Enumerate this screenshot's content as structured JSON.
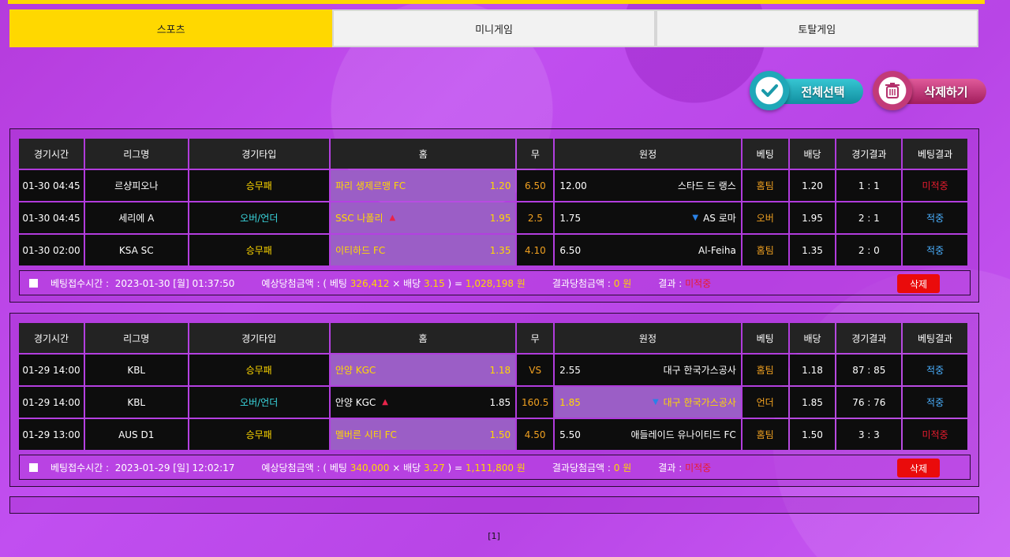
{
  "tabs": [
    "스포츠",
    "미니게임",
    "토탈게임"
  ],
  "actions": {
    "select_all": "전체선택",
    "delete": "삭제하기"
  },
  "headers": [
    "경기시간",
    "리그명",
    "경기타입",
    "홈",
    "무",
    "원정",
    "베팅",
    "배당",
    "경기결과",
    "베팅결과"
  ],
  "bets": [
    {
      "rows": [
        {
          "time": "01-30 04:45",
          "league": "르샹피오나",
          "type": "승무패",
          "home": "파리 생제르맹 FC",
          "home_odds": "1.20",
          "draw": "6.50",
          "away_odds": "12.00",
          "away": "스타드 드 랭스",
          "bet": "홈팀",
          "odds": "1.20",
          "score": "1 : 1",
          "result": "미적중"
        },
        {
          "time": "01-30 04:45",
          "league": "세리에 A",
          "type": "오버/언더",
          "home": "SSC 나폴리",
          "home_odds": "1.95",
          "draw": "2.5",
          "away_odds": "1.75",
          "away": "AS 로마",
          "bet": "오버",
          "odds": "1.95",
          "score": "2 : 1",
          "result": "적중"
        },
        {
          "time": "01-30 02:00",
          "league": "KSA SC",
          "type": "승무패",
          "home": "이티하드 FC",
          "home_odds": "1.35",
          "draw": "4.10",
          "away_odds": "6.50",
          "away": "Al-Feiha",
          "bet": "홈팀",
          "odds": "1.35",
          "score": "2 : 0",
          "result": "적중"
        }
      ],
      "info": {
        "time_label": "베팅접수시간 :",
        "time_value": "2023-01-30 [월] 01:37:50",
        "expected_label": "예상당첨금액 : ( 베팅",
        "bet_amount": "326,412",
        "times": "× 배당",
        "total_odds": "3.15",
        "eq": ") =",
        "expected_value": "1,028,198 원",
        "result_amount_label": "결과당첨금액 :",
        "result_amount": "0 원",
        "result_label": "결과 :",
        "result_value": "미적중",
        "delete": "삭제"
      }
    },
    {
      "rows": [
        {
          "time": "01-29 14:00",
          "league": "KBL",
          "type": "승무패",
          "home": "안양 KGC",
          "home_odds": "1.18",
          "draw": "VS",
          "away_odds": "2.55",
          "away": "대구 한국가스공사",
          "bet": "홈팀",
          "odds": "1.18",
          "score": "87 : 85",
          "result": "적중"
        },
        {
          "time": "01-29 14:00",
          "league": "KBL",
          "type": "오버/언더",
          "home": "안양 KGC",
          "home_odds": "1.85",
          "draw": "160.5",
          "away_odds": "1.85",
          "away": "대구 한국가스공사",
          "bet": "언더",
          "odds": "1.85",
          "score": "76 : 76",
          "result": "적중"
        },
        {
          "time": "01-29 13:00",
          "league": "AUS D1",
          "type": "승무패",
          "home": "멜버른 시티 FC",
          "home_odds": "1.50",
          "draw": "4.50",
          "away_odds": "5.50",
          "away": "애들레이드 유나이티드 FC",
          "bet": "홈팀",
          "odds": "1.50",
          "score": "3 : 3",
          "result": "미적중"
        }
      ],
      "info": {
        "time_label": "베팅접수시간 :",
        "time_value": "2023-01-29 [일] 12:02:17",
        "expected_label": "예상당첨금액 : ( 베팅",
        "bet_amount": "340,000",
        "times": "× 배당",
        "total_odds": "3.27",
        "eq": ") =",
        "expected_value": "1,111,800 원",
        "result_amount_label": "결과당첨금액 :",
        "result_amount": "0 원",
        "result_label": "결과 :",
        "result_value": "미적중",
        "delete": "삭제"
      }
    }
  ],
  "pagination": "[1]",
  "colors": {
    "accent": "#ffd800",
    "hit": "#4ab0ff",
    "miss": "#e81c2e",
    "delete": "#ea0b0b"
  }
}
